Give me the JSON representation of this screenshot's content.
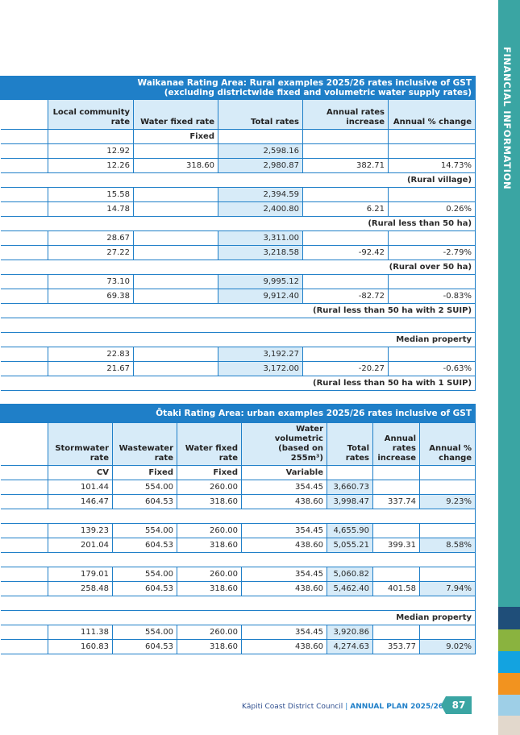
{
  "sidebar": {
    "title": "FINANCIAL INFORMATION",
    "colors": [
      "#1f4e79",
      "#8ab33f",
      "#13a3e0",
      "#f2931f",
      "#9ecfe7",
      "#e2d8cc"
    ]
  },
  "waikanae": {
    "title_line1": "Waikanae Rating Area: Rural examples 2025/26 rates inclusive of GST",
    "title_line2": "(excluding districtwide fixed and volumetric water supply rates)",
    "headers": [
      "",
      "Local community rate",
      "Water fixed rate",
      "Total rates",
      "Annual rates increase",
      "Annual % change"
    ],
    "basis": "Fixed",
    "groups": [
      {
        "rows": [
          [
            "12.92",
            "",
            "2,598.16",
            "",
            ""
          ],
          [
            "12.26",
            "318.60",
            "2,980.87",
            "382.71",
            "14.73%"
          ]
        ],
        "label": "(Rural village)"
      },
      {
        "rows": [
          [
            "15.58",
            "",
            "2,394.59",
            "",
            ""
          ],
          [
            "14.78",
            "",
            "2,400.80",
            "6.21",
            "0.26%"
          ]
        ],
        "label": "(Rural less than 50 ha)"
      },
      {
        "rows": [
          [
            "28.67",
            "",
            "3,311.00",
            "",
            ""
          ],
          [
            "27.22",
            "",
            "3,218.58",
            "-92.42",
            "-2.79%"
          ]
        ],
        "label": "(Rural over 50 ha)"
      },
      {
        "rows": [
          [
            "73.10",
            "",
            "9,995.12",
            "",
            ""
          ],
          [
            "69.38",
            "",
            "9,912.40",
            "-82.72",
            "-0.83%"
          ]
        ],
        "label": "(Rural less than 50 ha with 2 SUIP)"
      },
      {
        "pre_label": "Median property",
        "rows": [
          [
            "22.83",
            "",
            "3,192.27",
            "",
            ""
          ],
          [
            "21.67",
            "",
            "3,172.00",
            "-20.27",
            "-0.63%"
          ]
        ],
        "label": "(Rural less than 50 ha with 1 SUIP)"
      }
    ]
  },
  "otaki": {
    "title": "Ōtaki Rating Area: urban examples 2025/26 rates inclusive of GST",
    "headers": [
      "",
      "Stormwater rate",
      "Wastewater rate",
      "Water fixed rate",
      "Water volumetric (based on 255m³)",
      "Total rates",
      "Annual rates increase",
      "Annual % change"
    ],
    "basis": [
      "CV",
      "Fixed",
      "Fixed",
      "Variable"
    ],
    "groups": [
      {
        "rows": [
          [
            "101.44",
            "554.00",
            "260.00",
            "354.45",
            "3,660.73",
            "",
            ""
          ],
          [
            "146.47",
            "604.53",
            "318.60",
            "438.60",
            "3,998.47",
            "337.74",
            "9.23%"
          ]
        ]
      },
      {
        "rows": [
          [
            "139.23",
            "554.00",
            "260.00",
            "354.45",
            "4,655.90",
            "",
            ""
          ],
          [
            "201.04",
            "604.53",
            "318.60",
            "438.60",
            "5,055.21",
            "399.31",
            "8.58%"
          ]
        ]
      },
      {
        "rows": [
          [
            "179.01",
            "554.00",
            "260.00",
            "354.45",
            "5,060.82",
            "",
            ""
          ],
          [
            "258.48",
            "604.53",
            "318.60",
            "438.60",
            "5,462.40",
            "401.58",
            "7.94%"
          ]
        ]
      },
      {
        "pre_label": "Median property",
        "rows": [
          [
            "111.38",
            "554.00",
            "260.00",
            "354.45",
            "3,920.86",
            "",
            ""
          ],
          [
            "160.83",
            "604.53",
            "318.60",
            "438.60",
            "4,274.63",
            "353.77",
            "9.02%"
          ]
        ]
      }
    ]
  },
  "footer": {
    "org": "Kāpiti Coast District Council",
    "doc": "ANNUAL PLAN 2025/26",
    "page": "87"
  }
}
